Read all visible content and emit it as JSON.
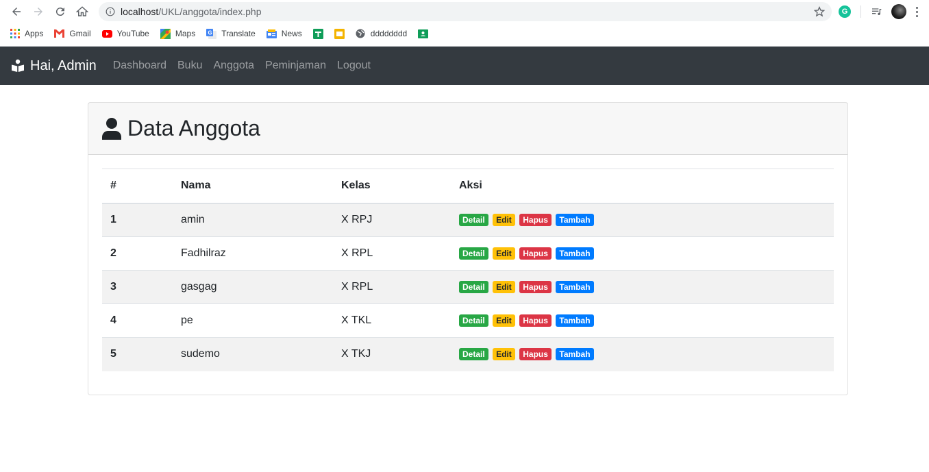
{
  "browser": {
    "url_host": "localhost",
    "url_path": "/UKL/anggota/index.php",
    "bookmarks": [
      {
        "label": "Apps",
        "icon": "apps-grid-icon"
      },
      {
        "label": "Gmail",
        "icon": "gmail-icon"
      },
      {
        "label": "YouTube",
        "icon": "youtube-icon"
      },
      {
        "label": "Maps",
        "icon": "maps-icon"
      },
      {
        "label": "Translate",
        "icon": "translate-icon"
      },
      {
        "label": "News",
        "icon": "news-icon"
      },
      {
        "label": "",
        "icon": "sheets-icon"
      },
      {
        "label": "",
        "icon": "slides-icon"
      },
      {
        "label": "dddddddd",
        "icon": "globe-icon"
      },
      {
        "label": "",
        "icon": "classroom-icon"
      }
    ]
  },
  "navbar": {
    "brand": "Hai, Admin",
    "links": [
      "Dashboard",
      "Buku",
      "Anggota",
      "Peminjaman",
      "Logout"
    ]
  },
  "page": {
    "title": "Data Anggota"
  },
  "table": {
    "headers": [
      "#",
      "Nama",
      "Kelas",
      "Aksi"
    ],
    "actions": [
      "Detail",
      "Edit",
      "Hapus",
      "Tambah"
    ],
    "rows": [
      {
        "num": "1",
        "nama": "amin",
        "kelas": "X RPJ"
      },
      {
        "num": "2",
        "nama": "Fadhilraz",
        "kelas": "X RPL"
      },
      {
        "num": "3",
        "nama": "gasgag",
        "kelas": "X RPL"
      },
      {
        "num": "4",
        "nama": "pe",
        "kelas": "X TKL"
      },
      {
        "num": "5",
        "nama": "sudemo",
        "kelas": "X TKJ"
      }
    ]
  },
  "colors": {
    "navbar": "#343a40",
    "detail": "#28a745",
    "edit": "#ffc107",
    "hapus": "#dc3545",
    "tambah": "#007bff"
  }
}
